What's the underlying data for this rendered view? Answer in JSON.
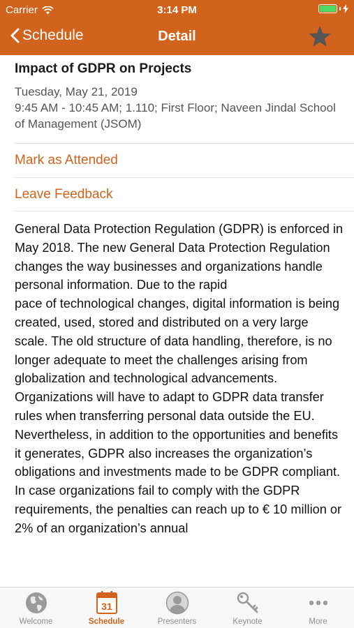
{
  "status_bar": {
    "carrier": "Carrier",
    "time": "3:14 PM"
  },
  "nav": {
    "back_label": "Schedule",
    "title": "Detail"
  },
  "session": {
    "title": "Impact of GDPR on Projects",
    "date": "Tuesday, May 21, 2019",
    "details": "9:45 AM - 10:45 AM; 1.110; First Floor; Naveen Jindal School of Management (JSOM)"
  },
  "actions": {
    "mark_attended": "Mark as Attended",
    "leave_feedback": "Leave Feedback"
  },
  "description": {
    "paragraph_1": "General Data Protection Regulation (GDPR) is enforced in May 2018. The new General Data Protection Regulation changes the way businesses and organizations handle personal information. Due to the rapid",
    "paragraph_2": "pace of technological changes, digital information is being created, used, stored and distributed on a very large scale. The old structure of data handling, therefore, is no longer adequate to meet the challenges arising from globalization and technological advancements. Organizations will have to adapt to GDPR data transfer rules when transferring personal data outside the EU. Nevertheless, in addition to the opportunities and benefits it generates, GDPR also increases the organization’s obligations and investments made to be GDPR compliant.",
    "paragraph_3": "In case organizations fail to comply with the GDPR requirements, the penalties can reach up to € 10 million or 2% of an organization’s annual"
  },
  "tabs": [
    {
      "label": "Welcome",
      "icon": "globe-icon"
    },
    {
      "label": "Schedule",
      "icon": "calendar-icon",
      "calendar_day": "31"
    },
    {
      "label": "Presenters",
      "icon": "person-icon"
    },
    {
      "label": "Keynote",
      "icon": "key-icon"
    },
    {
      "label": "More",
      "icon": "more-icon"
    }
  ],
  "colors": {
    "accent": "#d2631d",
    "tab_inactive": "#8e8e8e",
    "battery": "#4cd964"
  }
}
